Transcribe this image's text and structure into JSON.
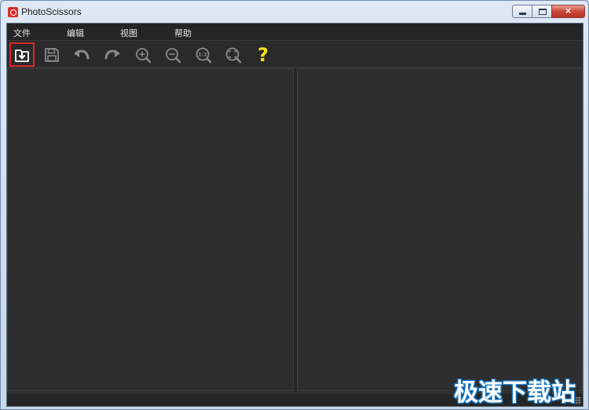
{
  "window": {
    "title": "PhotoScissors",
    "controls": {
      "minimize": "minimize",
      "maximize": "maximize",
      "close": "×"
    }
  },
  "menu": {
    "items": [
      {
        "label": "文件"
      },
      {
        "label": "编辑"
      },
      {
        "label": "视图"
      },
      {
        "label": "帮助"
      }
    ]
  },
  "toolbar": {
    "tools": [
      {
        "icon": "open-image-icon",
        "selected": true
      },
      {
        "icon": "save-icon"
      },
      {
        "icon": "undo-icon"
      },
      {
        "icon": "redo-icon"
      },
      {
        "icon": "zoom-in-icon"
      },
      {
        "icon": "zoom-out-icon"
      },
      {
        "icon": "actual-size-icon"
      },
      {
        "icon": "fit-window-icon"
      },
      {
        "icon": "help-icon",
        "glyph": "?"
      }
    ],
    "actual_size_label": "1:1"
  },
  "watermark": {
    "text": "极速下载站"
  },
  "colors": {
    "selection_outline": "#e0232a",
    "help_icon": "#f5e11a",
    "canvas": "#2e2e2e"
  }
}
